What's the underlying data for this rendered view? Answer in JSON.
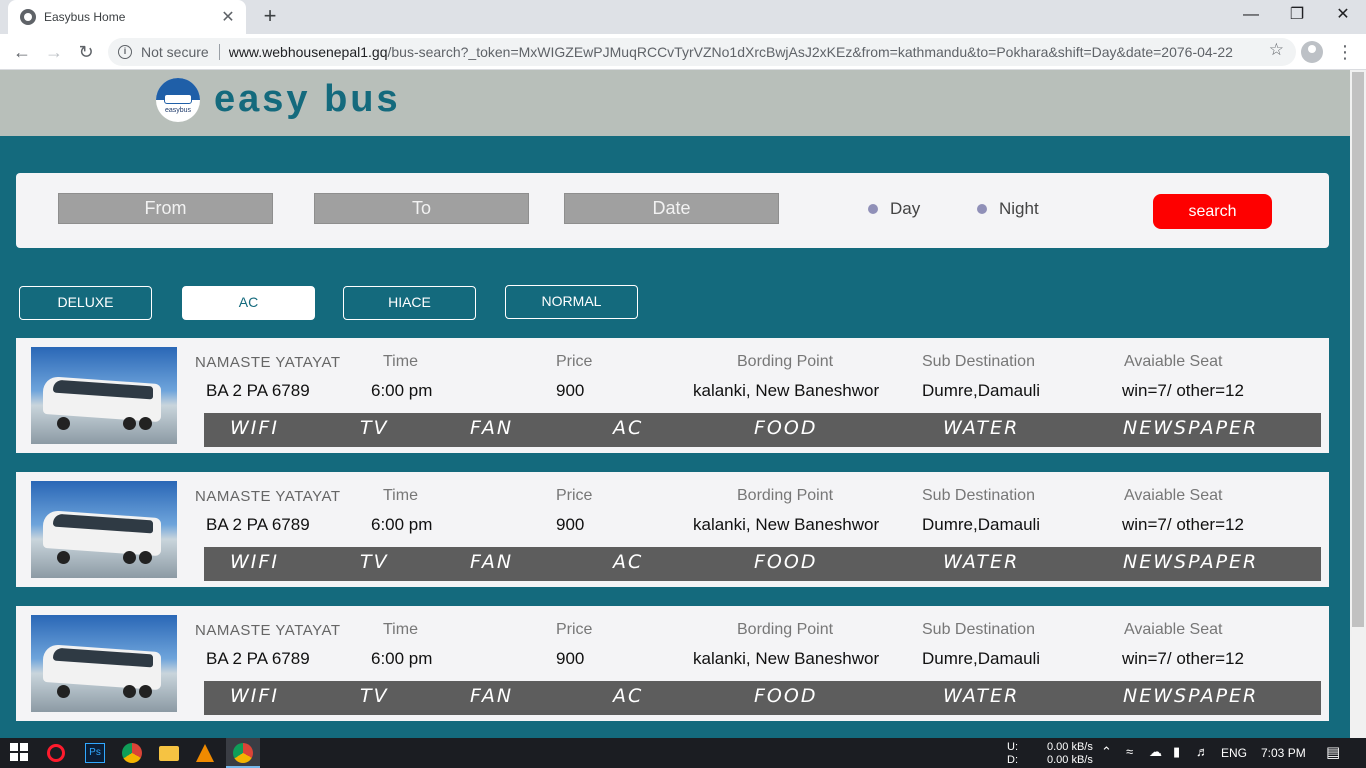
{
  "browser": {
    "tab_title": "Easybus Home",
    "tab_close": "✕",
    "new_tab": "+",
    "security_label": "Not secure",
    "url_host": "www.webhousenepal1.gq",
    "url_path": "/bus-search?_token=MxWIGZEwPJMuqRCCvTyrVZNo1dXrcBwjAsJ2xKEz&from=kathmandu&to=Pokhara&shift=Day&date=2076-04-22",
    "window_controls": {
      "minimize": "—",
      "restore": "❐",
      "close": "✕"
    }
  },
  "site": {
    "logo_text": "easybus",
    "brand": "easy bus"
  },
  "search": {
    "from_placeholder": "From",
    "to_placeholder": "To",
    "date_placeholder": "Date",
    "day_label": "Day",
    "night_label": "Night",
    "search_label": "search"
  },
  "filters": [
    {
      "label": "DELUXE",
      "active": false
    },
    {
      "label": "AC",
      "active": true
    },
    {
      "label": "HIACE",
      "active": false
    },
    {
      "label": "NORMAL",
      "active": false
    }
  ],
  "headers": {
    "time": "Time",
    "price": "Price",
    "boarding": "Bording Point",
    "sub_destination": "Sub Destination",
    "seats": "Avaiable Seat"
  },
  "buses": [
    {
      "operator": "NAMASTE YATAYAT",
      "bus_number": "BA 2 PA 6789",
      "time": "6:00 pm",
      "price": "900",
      "boarding_point": "kalanki, New Baneshwor",
      "sub_destination": "Dumre,Damauli",
      "seats": "win=7/ other=12",
      "amenities": [
        "WIFI",
        "TV",
        "FAN",
        "AC",
        "FOOD",
        "WATER",
        "NEWSPAPER"
      ]
    },
    {
      "operator": "NAMASTE YATAYAT",
      "bus_number": "BA 2 PA 6789",
      "time": "6:00 pm",
      "price": "900",
      "boarding_point": "kalanki, New Baneshwor",
      "sub_destination": "Dumre,Damauli",
      "seats": "win=7/ other=12",
      "amenities": [
        "WIFI",
        "TV",
        "FAN",
        "AC",
        "FOOD",
        "WATER",
        "NEWSPAPER"
      ]
    },
    {
      "operator": "NAMASTE YATAYAT",
      "bus_number": "BA 2 PA 6789",
      "time": "6:00 pm",
      "price": "900",
      "boarding_point": "kalanki, New Baneshwor",
      "sub_destination": "Dumre,Damauli",
      "seats": "win=7/ other=12",
      "amenities": [
        "WIFI",
        "TV",
        "FAN",
        "AC",
        "FOOD",
        "WATER",
        "NEWSPAPER"
      ]
    }
  ],
  "taskbar": {
    "upload_label": "U:",
    "download_label": "D:",
    "upload_speed": "0.00 kB/s",
    "download_speed": "0.00 kB/s",
    "language": "ENG",
    "clock": "7:03 PM"
  },
  "colors": {
    "page_bg": "#146a7d",
    "header_bg": "#b8bfba",
    "search_button": "#fe0000",
    "amenity_bar": "#5d5d5d"
  }
}
